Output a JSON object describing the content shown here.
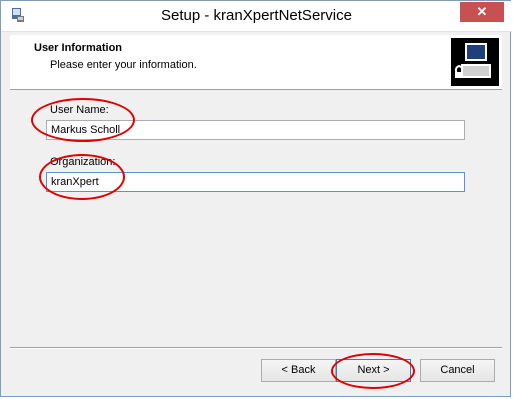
{
  "window": {
    "title": "Setup - kranXpertNetService"
  },
  "header": {
    "title": "User Information",
    "subtitle": "Please enter your information."
  },
  "form": {
    "user_name_label": "User Name:",
    "user_name_value": "Markus Scholl",
    "organization_label": "Organization:",
    "organization_value": "kranXpert"
  },
  "buttons": {
    "back_label": "< Back",
    "next_label": "Next >",
    "cancel_label": "Cancel"
  },
  "icons": {
    "app": "setup-app-icon",
    "wizard": "computer-setup-icon",
    "close": "close-icon"
  },
  "colors": {
    "annotation": "#e10000",
    "close_button": "#c75050"
  }
}
